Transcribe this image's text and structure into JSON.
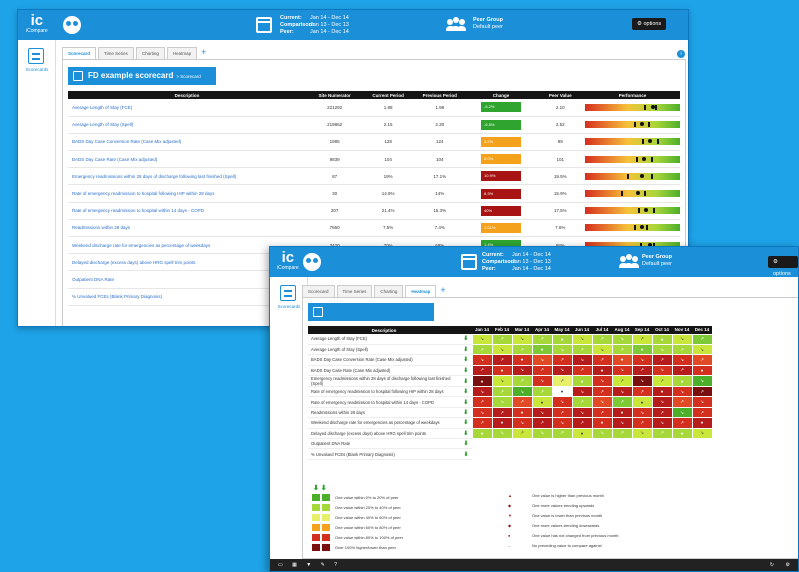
{
  "app": {
    "logo_text": "ic",
    "logo_sub": "iCompare"
  },
  "header": {
    "periods": [
      {
        "label": "Current:",
        "value": "Jan 14 - Dec 14"
      },
      {
        "label": "Comparison:",
        "value": "Jan 13 - Dec 13"
      },
      {
        "label": "Peer:",
        "value": "Jan 14 - Dec 14"
      }
    ],
    "peer_group_label": "Peer Group",
    "peer_group_value": "Default peer",
    "options_label": "options"
  },
  "sidebar": {
    "label": "Scorecards"
  },
  "tabs": [
    "Scorecard",
    "Time Series",
    "Charting",
    "Heatmap"
  ],
  "tab_add": "+",
  "info_icon": "i",
  "scorecard": {
    "title": "FD example scorecard",
    "breadcrumb": "> Scorecard",
    "columns": [
      "Description",
      "Site Numerator",
      "Current Period",
      "Previous Period",
      "Change",
      "Peer Value",
      "Performance"
    ],
    "rows": [
      {
        "desc": "Average Length of Stay (FCE)",
        "num": "221292",
        "cur": "1.88",
        "prev": "1.98",
        "chg": "-5.2%",
        "peer": "2.10",
        "color": "#2fa52f",
        "marks": [
          62,
          70,
          74
        ]
      },
      {
        "desc": "Average Length of Stay (Spell)",
        "num": "219862",
        "cur": "2.15",
        "prev": "2.30",
        "chg": "-6.5%",
        "peer": "2.52",
        "color": "#2fa52f",
        "marks": [
          52,
          58,
          66
        ]
      },
      {
        "desc": "BADS Day Case Conversion Rate (Case Mix adjusted)",
        "num": "1995",
        "cur": "128",
        "prev": "124",
        "chg": "3.2%",
        "peer": "99",
        "color": "#f4a21c",
        "marks": [
          60,
          66,
          76
        ]
      },
      {
        "desc": "BADS Day Case Rate (Case Mix adjusted)",
        "num": "9839",
        "cur": "104",
        "prev": "104",
        "chg": "0.0%",
        "peer": "101",
        "color": "#f4a21c",
        "marks": [
          54,
          60,
          70
        ]
      },
      {
        "desc": "Emergency readmissions within 28 days of discharge following last finished (Spell)",
        "num": "87",
        "cur": "19%",
        "prev": "17.1%",
        "chg": "10.9%",
        "peer": "19.5%",
        "color": "#a81414",
        "marks": [
          44,
          58,
          70
        ]
      },
      {
        "desc": "Rate of emergency readmission to hospital following HIP within 28 days",
        "num": "30",
        "cur": "14.9%",
        "prev": "14%",
        "chg": "6.3%",
        "peer": "15.9%",
        "color": "#a81414",
        "marks": [
          38,
          54,
          62
        ]
      },
      {
        "desc": "Rate of emergency readmission to hospital within 14 days - COPD",
        "num": "207",
        "cur": "21.4%",
        "prev": "15.3%",
        "chg": "40%",
        "peer": "17.5%",
        "color": "#a81414",
        "marks": [
          56,
          62,
          72
        ]
      },
      {
        "desc": "Readmissions within 28 days",
        "num": "7660",
        "cur": "7.5%",
        "prev": "7.4%",
        "chg": "1.01%",
        "peer": "7.6%",
        "color": "#f4a21c",
        "marks": [
          52,
          58,
          64
        ]
      },
      {
        "desc": "Weekend discharge rate for emergencies as percentage of weekdays",
        "num": "3420",
        "cur": "70%",
        "prev": "69%",
        "chg": "1.4%",
        "peer": "68%",
        "color": "#2fa52f",
        "marks": [
          58,
          66,
          72
        ]
      },
      {
        "desc": "Delayed discharge (excess days) above HRG spell trim points",
        "num": "",
        "cur": "",
        "prev": "",
        "chg": "",
        "peer": "",
        "color": "",
        "marks": []
      },
      {
        "desc": "Outpatient DNA Rate",
        "num": "",
        "cur": "",
        "prev": "",
        "chg": "",
        "peer": "",
        "color": "",
        "marks": []
      },
      {
        "desc": "% Unvalued FCEs (Blank Primary Diagnosis)",
        "num": "",
        "cur": "",
        "prev": "",
        "chg": "",
        "peer": "",
        "color": "",
        "marks": []
      }
    ]
  },
  "heatmap": {
    "columns": [
      "Description",
      "Jan 14",
      "Feb 14",
      "Mar 14",
      "Apr 14",
      "May 14",
      "Jun 14",
      "Jul 14",
      "Aug 14",
      "Sep 14",
      "Oct 14",
      "Nov 14",
      "Dec 14"
    ],
    "rows": [
      {
        "desc": "Average Length of Stay (FCE)",
        "cells": [
          "#c9e63a",
          "#a6d83a",
          "#c9e63a",
          "#a6d83a",
          "#a6d83a",
          "#c9e63a",
          "#a6d83a",
          "#a6d83a",
          "#c9e63a",
          "#a6d83a",
          "#c9e63a",
          "#7ec936"
        ]
      },
      {
        "desc": "Average Length of Stay (Spell)",
        "cells": [
          "#a6d83a",
          "#c9e63a",
          "#a6d83a",
          "#7ec936",
          "#a6d83a",
          "#a6d83a",
          "#c9e63a",
          "#a6d83a",
          "#7ec936",
          "#a6d83a",
          "#a6d83a",
          "#c9e63a"
        ]
      },
      {
        "desc": "BADS Day Case Conversion Rate (Case Mix adjusted)",
        "cells": [
          "#d32f1e",
          "#b71c1c",
          "#d32f1e",
          "#e04a24",
          "#d32f1e",
          "#b71c1c",
          "#d32f1e",
          "#e04a24",
          "#d32f1e",
          "#b71c1c",
          "#d32f1e",
          "#e04a24"
        ]
      },
      {
        "desc": "BADS Day Case Rate (Case Mix adjusted)",
        "cells": [
          "#b71c1c",
          "#d32f1e",
          "#b71c1c",
          "#d32f1e",
          "#b71c1c",
          "#d32f1e",
          "#b71c1c",
          "#d32f1e",
          "#b71c1c",
          "#d32f1e",
          "#b71c1c",
          "#d32f1e"
        ]
      },
      {
        "desc": "Emergency readmissions within 28 days of discharge following last finished (Spell)",
        "cells": [
          "#7a0f0f",
          "#c9e63a",
          "#a6d83a",
          "#d32f1e",
          "#e8f06a",
          "#a6d83a",
          "#d32f1e",
          "#c9e63a",
          "#7a0f0f",
          "#c9e63a",
          "#a6d83a",
          "#4caf2a"
        ]
      },
      {
        "desc": "Rate of emergency readmission to hospital following HIP within 28 days",
        "cells": [
          "#b71c1c",
          "#a6d83a",
          "#4caf2a",
          "#a6d83a",
          "#ffffff",
          "#b71c1c",
          "#d32f1e",
          "#b71c1c",
          "#d32f1e",
          "#b71c1c",
          "#d32f1e",
          "#7a0f0f"
        ]
      },
      {
        "desc": "Rate of emergency readmission to hospital within 14 days - COPD",
        "cells": [
          "#d32f1e",
          "#a6d83a",
          "#e04a24",
          "#c9e63a",
          "#d32f1e",
          "#a6d83a",
          "#e04a24",
          "#7ec936",
          "#c9e63a",
          "#b71c1c",
          "#e04a24",
          "#d32f1e"
        ]
      },
      {
        "desc": "Readmissions within 28 days",
        "cells": [
          "#d32f1e",
          "#b71c1c",
          "#d32f1e",
          "#b71c1c",
          "#d32f1e",
          "#b71c1c",
          "#d32f1e",
          "#b71c1c",
          "#d32f1e",
          "#b71c1c",
          "#4caf2a",
          "#d32f1e"
        ]
      },
      {
        "desc": "Weekend discharge rate for emergencies as percentage of weekdays",
        "cells": [
          "#d32f1e",
          "#b71c1c",
          "#d32f1e",
          "#b71c1c",
          "#d32f1e",
          "#b71c1c",
          "#d32f1e",
          "#b71c1c",
          "#d32f1e",
          "#b71c1c",
          "#d32f1e",
          "#b71c1c"
        ]
      },
      {
        "desc": "Delayed discharge (excess days) above HRG spell trim points",
        "cells": [
          "#a6d83a",
          "#a6d83a",
          "#c9e63a",
          "#a6d83a",
          "#a6d83a",
          "#c9e63a",
          "#a6d83a",
          "#a6d83a",
          "#c9e63a",
          "#a6d83a",
          "#a6d83a",
          "#c9e63a"
        ]
      },
      {
        "desc": "Outpatient DNA Rate",
        "cells": []
      },
      {
        "desc": "% Unvalued FCEs (Blank Primary Diagnosis)",
        "cells": []
      }
    ],
    "legend_left": [
      {
        "color": "#4caf2a",
        "text": "One value within 0% to 20% of peer"
      },
      {
        "color": "#a6d83a",
        "text": "One value within 20% to 40% of peer"
      },
      {
        "color": "#e8f06a",
        "text": "One value within 40% to 60% of peer"
      },
      {
        "color": "#f4a21c",
        "text": "One value within 60% to 80% of peer"
      },
      {
        "color": "#d32f1e",
        "text": "One value within 80% to 100% of peer"
      },
      {
        "color": "#7a0f0f",
        "text": "Over 100% higher/lower than peer"
      }
    ],
    "legend_right": [
      {
        "sym": "▲",
        "text": "One value is higher than previous month"
      },
      {
        "sym": "◆",
        "text": "One more values trending upwards"
      },
      {
        "sym": "▼",
        "text": "One value is lower than previous month"
      },
      {
        "sym": "◆",
        "text": "One more values trending downwards"
      },
      {
        "sym": "●",
        "text": "One value has not changed from previous month"
      },
      {
        "sym": "–",
        "text": "No preceding value to compare against"
      }
    ]
  },
  "colors": {
    "header": "#1b8fd8",
    "background": "#1ea3e8",
    "improving": "#2fa52f",
    "warning": "#f4a21c",
    "worsening": "#a81414"
  }
}
